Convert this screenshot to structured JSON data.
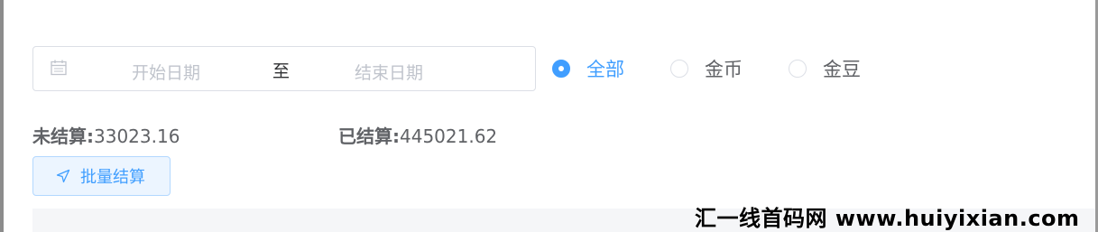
{
  "date_range": {
    "start_placeholder": "开始日期",
    "separator": "至",
    "end_placeholder": "结束日期"
  },
  "filter": {
    "options": [
      {
        "label": "全部",
        "checked": true
      },
      {
        "label": "金币",
        "checked": false
      },
      {
        "label": "金豆",
        "checked": false
      }
    ]
  },
  "stats": {
    "unsettled_label": "未结算:",
    "unsettled_value": "33023.16",
    "settled_label": "已结算:",
    "settled_value": "445021.62"
  },
  "actions": {
    "batch_settle_label": "批量结算"
  },
  "watermark": "汇一线首码网 www.huiyixian.com",
  "colors": {
    "accent": "#409eff",
    "text": "#606266",
    "placeholder": "#c0c4cc",
    "border": "#dcdfe6"
  }
}
